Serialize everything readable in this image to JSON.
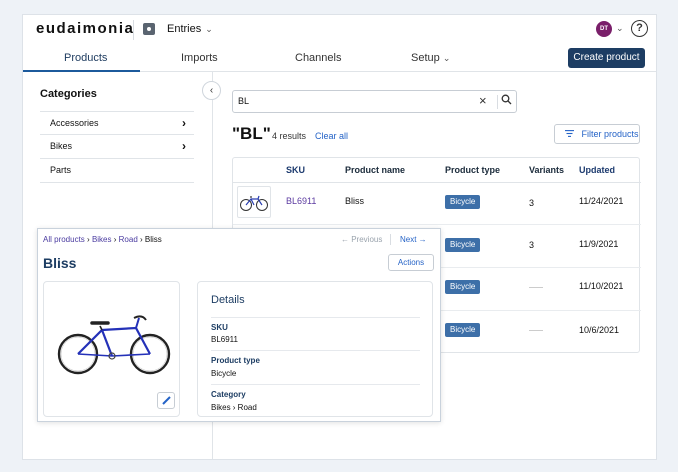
{
  "header": {
    "logo": "eudaimonia",
    "section": "Entries",
    "avatar": "DT",
    "help": "?"
  },
  "nav": {
    "tabs": [
      "Products",
      "Imports",
      "Channels",
      "Setup"
    ],
    "create_label": "Create product"
  },
  "sidebar": {
    "title": "Categories",
    "items": [
      "Accessories",
      "Bikes",
      "Parts"
    ]
  },
  "search": {
    "value": "BL",
    "query_display": "\"BL\"",
    "count": "4 results",
    "clear_label": "Clear all",
    "filter_label": "Filter products"
  },
  "table": {
    "headers": [
      "SKU",
      "Product name",
      "Product type",
      "Variants",
      "Updated"
    ],
    "rows": [
      {
        "sku": "BL6911",
        "name": "Bliss",
        "type": "Bicycle",
        "variants": "3",
        "updated": "11/24/2021"
      },
      {
        "sku": "",
        "name": "",
        "type": "Bicycle",
        "variants": "3",
        "updated": "11/9/2021"
      },
      {
        "sku": "",
        "name": "",
        "type": "Bicycle",
        "variants": "",
        "updated": "11/10/2021"
      },
      {
        "sku": "",
        "name": "",
        "type": "Bicycle",
        "variants": "",
        "updated": "10/6/2021"
      }
    ]
  },
  "detail": {
    "breadcrumb": {
      "all": "All products",
      "cat": "Bikes",
      "sub": "Road",
      "current": "Bliss",
      "sep": "›"
    },
    "prev": "← Previous",
    "next": "Next →",
    "title": "Bliss",
    "actions": "Actions",
    "card_title": "Details",
    "fields": [
      {
        "label": "SKU",
        "value": "BL6911"
      },
      {
        "label": "Product type",
        "value": "Bicycle"
      },
      {
        "label": "Category",
        "value": "Bikes › Road"
      }
    ]
  },
  "colors": {
    "primary": "#1d3d63",
    "link": "#2563c7",
    "badge": "#3d6fa8",
    "avatar": "#7a1f6a"
  }
}
